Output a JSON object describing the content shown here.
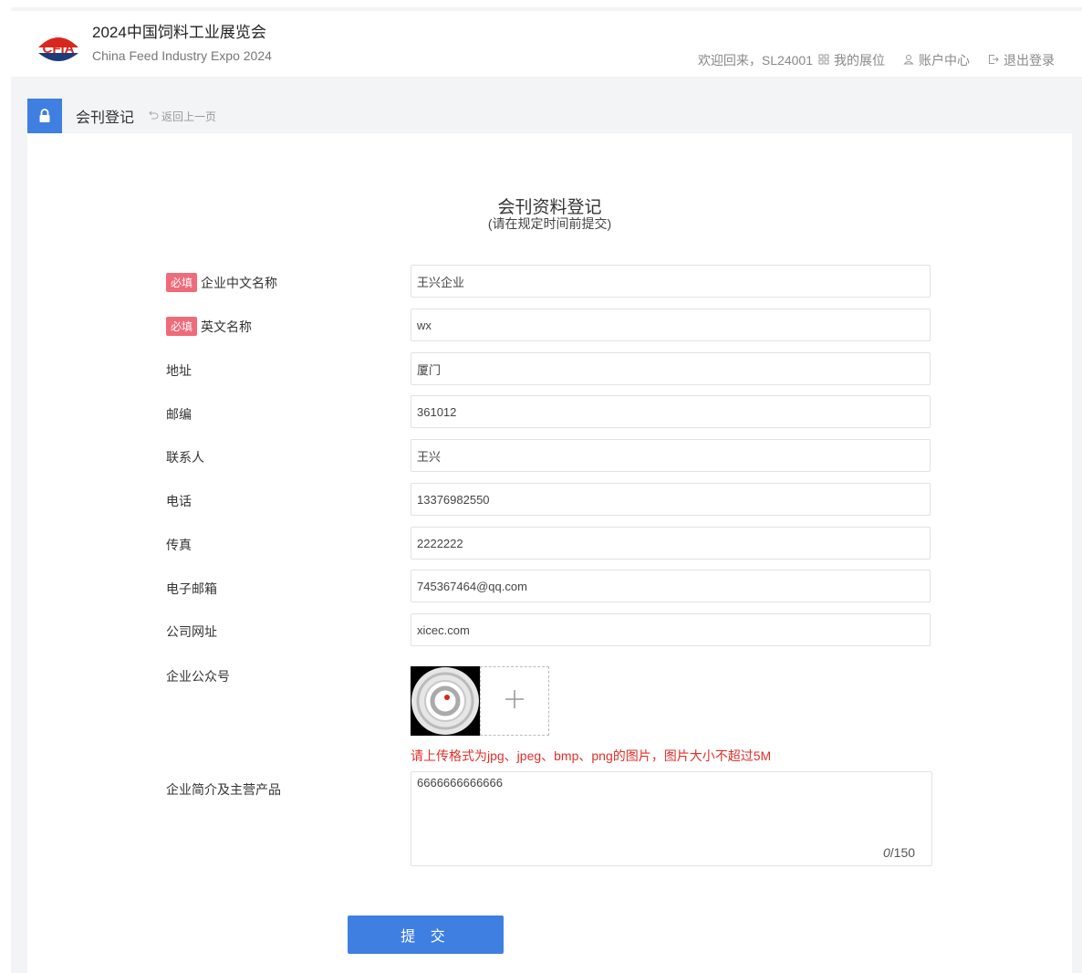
{
  "header": {
    "title_cn": "2024中国饲料工业展览会",
    "title_en": "China Feed Industry Expo 2024",
    "logo_text": "CFIA",
    "welcome": "欢迎回来，SL24001",
    "my_booth": "我的展位",
    "account": "账户中心",
    "logout": "退出登录"
  },
  "breadcrumb": {
    "title": "会刊登记",
    "back": "返回上一页"
  },
  "form": {
    "title": "会刊资料登记",
    "subtitle": "(请在规定时间前提交)",
    "required_tag": "必填",
    "fields": {
      "company_cn": {
        "label": "企业中文名称",
        "value": "王兴企业"
      },
      "company_en": {
        "label": "英文名称",
        "value": "wx"
      },
      "address": {
        "label": "地址",
        "value": "厦门"
      },
      "postcode": {
        "label": "邮编",
        "value": "361012"
      },
      "contact": {
        "label": "联系人",
        "value": "王兴"
      },
      "phone": {
        "label": "电话",
        "value": "13376982550"
      },
      "fax": {
        "label": "传真",
        "value": "2222222"
      },
      "email": {
        "label": "电子邮箱",
        "value": "745367464@qq.com"
      },
      "website": {
        "label": "公司网址",
        "value": "xicec.com"
      },
      "wechat": {
        "label": "企业公众号"
      },
      "intro": {
        "label": "企业简介及主营产品",
        "value": "6666666666666"
      }
    },
    "upload_hint": "请上传格式为jpg、jpeg、bmp、png的图片，图片大小不超过5M",
    "counter_current": "0",
    "counter_max": "/150",
    "submit": "提 交"
  },
  "colors": {
    "primary": "#3f7fe2",
    "required": "#ef6b7a",
    "hint": "#e0302a"
  }
}
